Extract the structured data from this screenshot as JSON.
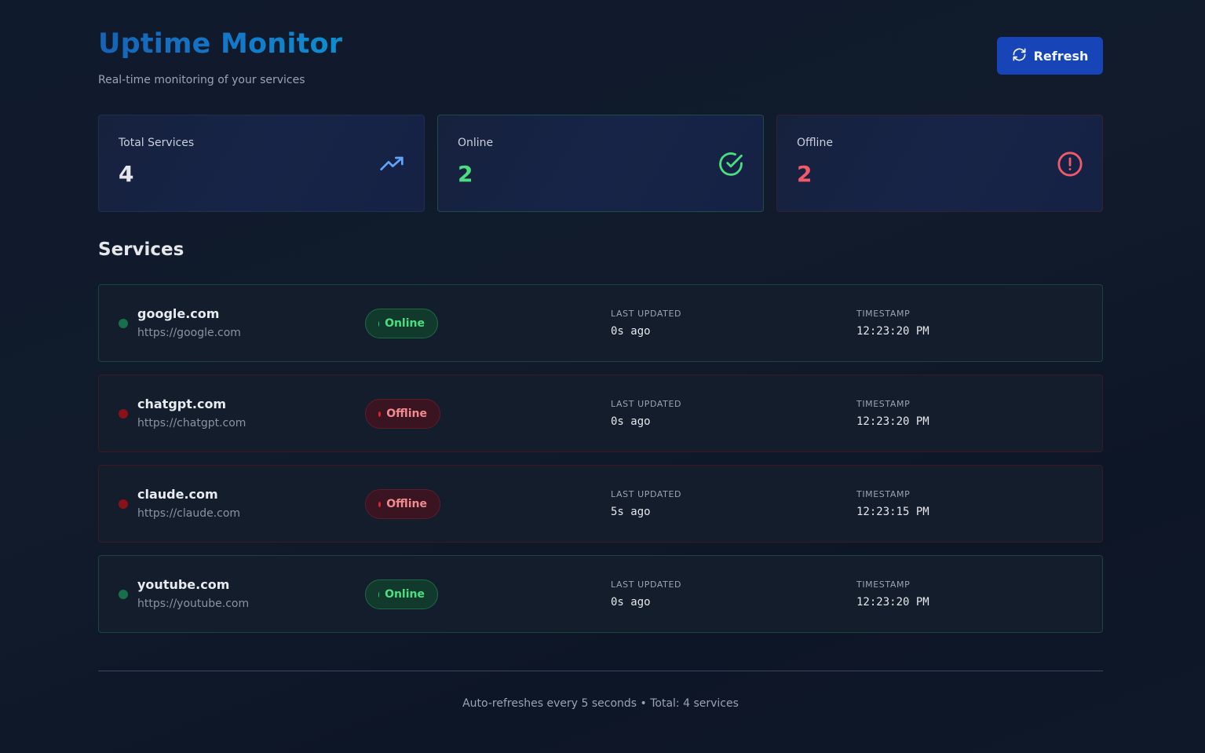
{
  "header": {
    "title": "Uptime Monitor",
    "subtitle": "Real-time monitoring of your services",
    "refresh_label": "Refresh"
  },
  "stats": {
    "total": {
      "label": "Total Services",
      "value": "4",
      "icon": "trending-up-icon",
      "color": "#60a5fa"
    },
    "online": {
      "label": "Online",
      "value": "2",
      "icon": "check-circle-icon",
      "color": "#4ade80"
    },
    "offline": {
      "label": "Offline",
      "value": "2",
      "icon": "alert-circle-icon",
      "color": "#f05a6a"
    }
  },
  "services_title": "Services",
  "columns": {
    "last_updated": "LAST UPDATED",
    "timestamp": "TIMESTAMP"
  },
  "services": [
    {
      "name": "google.com",
      "url": "https://google.com",
      "status": "Online",
      "last_updated": "0s ago",
      "timestamp": "12:23:20 PM"
    },
    {
      "name": "chatgpt.com",
      "url": "https://chatgpt.com",
      "status": "Offline",
      "last_updated": "0s ago",
      "timestamp": "12:23:20 PM"
    },
    {
      "name": "claude.com",
      "url": "https://claude.com",
      "status": "Offline",
      "last_updated": "5s ago",
      "timestamp": "12:23:15 PM"
    },
    {
      "name": "youtube.com",
      "url": "https://youtube.com",
      "status": "Online",
      "last_updated": "0s ago",
      "timestamp": "12:23:20 PM"
    }
  ],
  "footer": "Auto-refreshes every 5 seconds • Total: 4 services"
}
